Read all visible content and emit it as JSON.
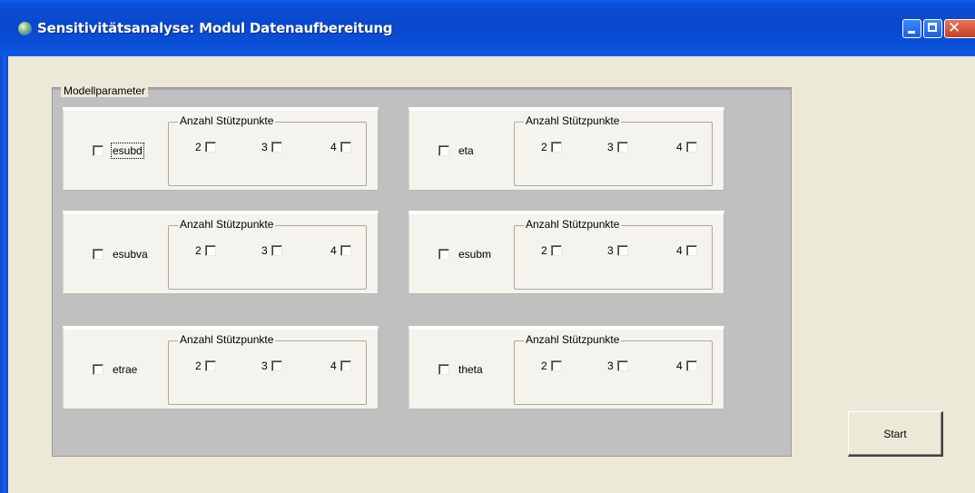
{
  "window": {
    "title": "Sensitivitätsanalyse: Modul Datenaufbereitung",
    "icon": "globe-icon",
    "buttons": [
      "minimize",
      "maximize",
      "close"
    ]
  },
  "group": {
    "label": "Modellparameter"
  },
  "panels": [
    {
      "param": "esubd",
      "checked": false,
      "focused": true,
      "sub_label": "Anzahl Stützpunkte",
      "options": [
        "2",
        "3",
        "4"
      ]
    },
    {
      "param": "eta",
      "checked": false,
      "focused": false,
      "sub_label": "Anzahl Stützpunkte",
      "options": [
        "2",
        "3",
        "4"
      ]
    },
    {
      "param": "esubva",
      "checked": false,
      "focused": false,
      "sub_label": "Anzahl Stützpunkte",
      "options": [
        "2",
        "3",
        "4"
      ]
    },
    {
      "param": "esubm",
      "checked": false,
      "focused": false,
      "sub_label": "Anzahl Stützpunkte",
      "options": [
        "2",
        "3",
        "4"
      ]
    },
    {
      "param": "etrae",
      "checked": false,
      "focused": false,
      "sub_label": "Anzahl Stützpunkte",
      "options": [
        "2",
        "3",
        "4"
      ]
    },
    {
      "param": "theta",
      "checked": false,
      "focused": false,
      "sub_label": "Anzahl Stützpunkte",
      "options": [
        "2",
        "3",
        "4"
      ]
    }
  ],
  "start_button": {
    "label": "Start"
  }
}
